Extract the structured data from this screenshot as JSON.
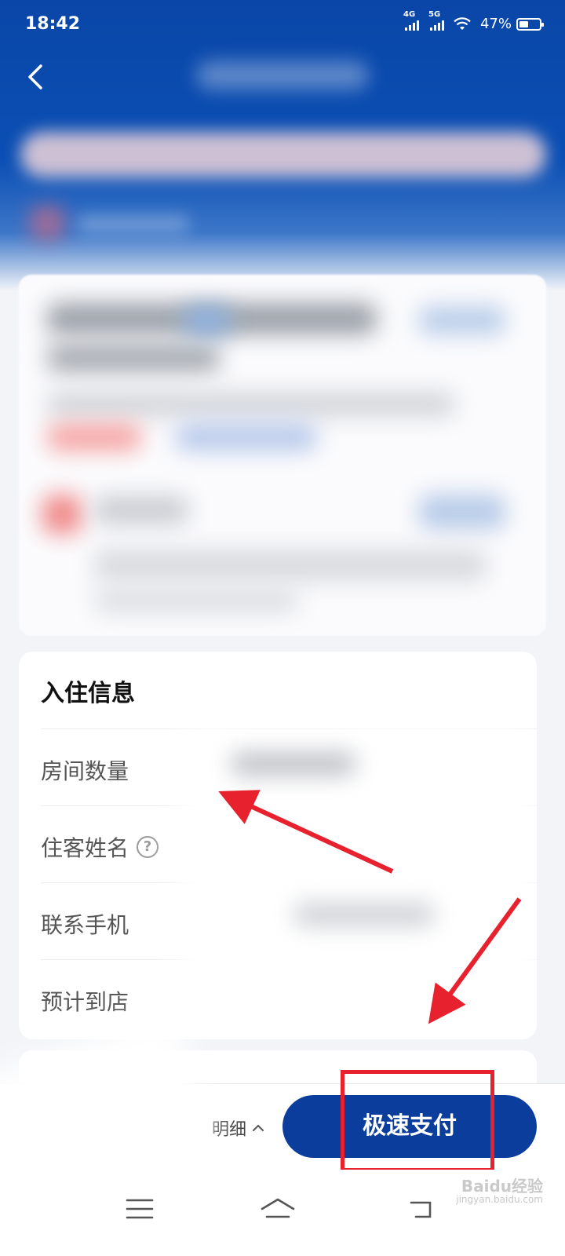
{
  "status_bar": {
    "time": "18:42",
    "network_1": "4G",
    "network_2": "5G",
    "battery_percent": "47%",
    "battery_level": 0.47
  },
  "guest_info": {
    "title": "入住信息",
    "rows": [
      {
        "label": "房间数量"
      },
      {
        "label": "住客姓名",
        "has_help": true
      },
      {
        "label": "联系手机"
      },
      {
        "label": "预计到店"
      }
    ]
  },
  "bottom_bar": {
    "detail_label": "明细",
    "pay_label": "极速支付"
  },
  "watermark": {
    "text": "Baidu经验",
    "sub": "jingyan.baidu.com"
  },
  "colors": {
    "brand_blue": "#0b3e9c",
    "header_blue": "#0a46a8",
    "annotation_red": "#e8212f"
  },
  "icons": {
    "back": "chevron-left-icon",
    "help": "question-circle-icon",
    "detail_toggle": "chevron-up-icon",
    "nav_menu": "menu-icon",
    "nav_home": "home-icon",
    "nav_back": "back-icon"
  }
}
